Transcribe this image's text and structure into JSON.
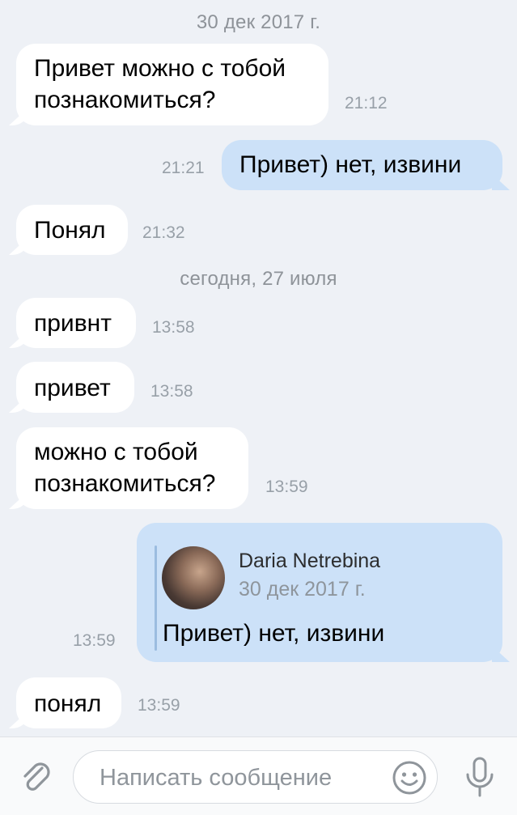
{
  "dates": {
    "first": "30 дек 2017 г.",
    "second": "сегодня, 27 июля"
  },
  "messages": [
    {
      "direction": "in",
      "lines": [
        "Привет можно с тобой",
        "познакомиться?"
      ],
      "time": "21:12"
    },
    {
      "direction": "out",
      "lines": [
        "Привет) нет, извини"
      ],
      "time": "21:21"
    },
    {
      "direction": "in",
      "lines": [
        "Понял"
      ],
      "time": "21:32"
    },
    {
      "direction": "in",
      "lines": [
        "привнт"
      ],
      "time": "13:58"
    },
    {
      "direction": "in",
      "lines": [
        "привет"
      ],
      "time": "13:58"
    },
    {
      "direction": "in",
      "lines": [
        "можно с тобой",
        "познакомиться?"
      ],
      "time": "13:59"
    },
    {
      "direction": "out",
      "forwarded": {
        "author": "Daria Netrebina",
        "date": "30 дек 2017 г.",
        "text": "Привет) нет, извини"
      },
      "time": "13:59"
    },
    {
      "direction": "in",
      "lines": [
        "понял"
      ],
      "time": "13:59"
    }
  ],
  "composer": {
    "placeholder": "Написать сообщение",
    "icons": [
      "paperclip-icon",
      "emoji-icon",
      "microphone-icon"
    ]
  },
  "colors": {
    "background": "#eef1f6",
    "incoming_bubble": "#ffffff",
    "outgoing_bubble": "#cce1f8",
    "timestamp": "#98a0a8",
    "icon": "#8f959b"
  }
}
